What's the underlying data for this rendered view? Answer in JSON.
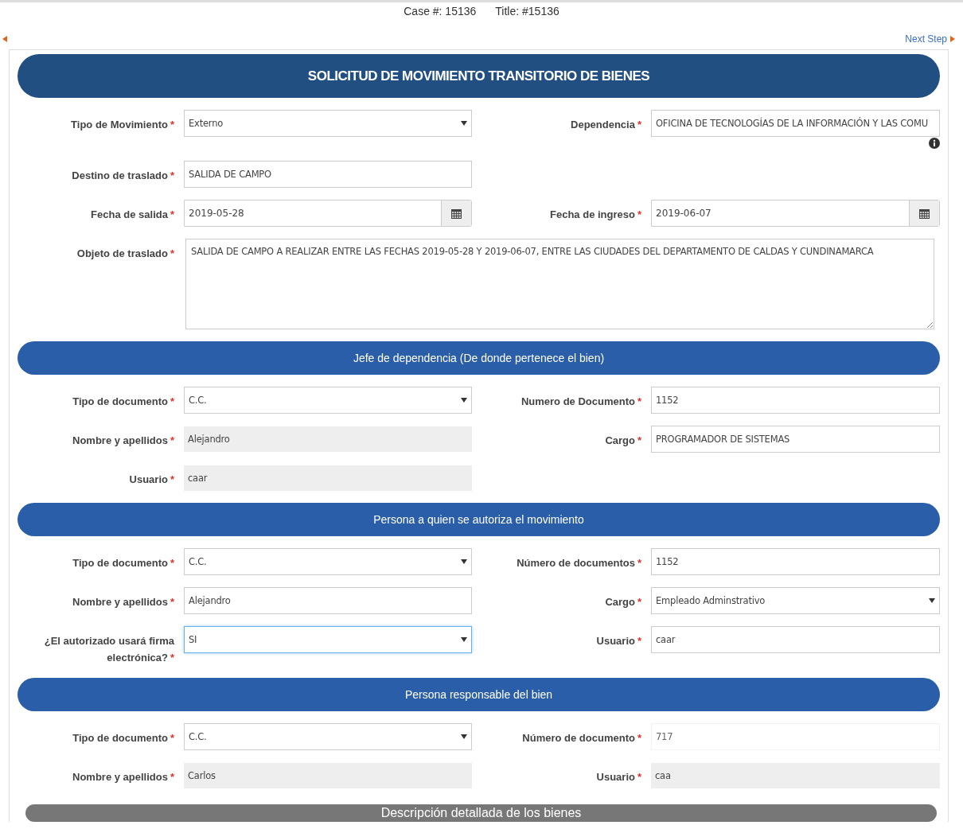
{
  "case_bar": {
    "case": "Case #: 15136",
    "title": "Title: #15136"
  },
  "nav": {
    "next": "Next Step"
  },
  "sections": [
    {
      "kind": "main",
      "title": "SOLICITUD DE MOVIMIENTO TRANSITORIO DE BIENES",
      "rows": [
        {
          "left": {
            "label": "Tipo de Movimiento",
            "mark": "*",
            "kind": "select",
            "value": "Externo",
            "focused": false
          },
          "right": {
            "label": "Dependencia",
            "mark": "*",
            "kind": "text",
            "value": "OFICINA DE TECNOLOGÍAS DE LA INFORMACIÓN Y LAS COMU",
            "info": true
          }
        },
        {
          "left": {
            "label": "Destino de traslado",
            "mark": "*",
            "kind": "text",
            "value": "SALIDA DE CAMPO"
          }
        },
        {
          "left": {
            "label": "Fecha de salida",
            "mark": "*",
            "kind": "date",
            "value": "2019-05-28"
          },
          "right": {
            "label": "Fecha de ingreso",
            "mark": "*",
            "kind": "date",
            "value": "2019-06-07"
          }
        },
        {
          "wide": {
            "label": "Objeto de traslado",
            "mark": "*",
            "kind": "textarea",
            "value": "SALIDA DE CAMPO A REALIZAR ENTRE LAS FECHAS 2019-05-28 Y 2019-06-07, ENTRE LAS CIUDADES DEL DEPARTAMENTO DE CALDAS Y CUNDINAMARCA"
          }
        }
      ]
    },
    {
      "kind": "sub",
      "title": "Jefe de dependencia (De donde pertenece el bien)",
      "rows": [
        {
          "left": {
            "label": "Tipo de documento",
            "mark": "*",
            "kind": "select",
            "value": "C.C.",
            "focused": false
          },
          "right": {
            "label": "Numero de Documento",
            "mark": "*",
            "kind": "text",
            "value": "1152"
          }
        },
        {
          "left": {
            "label": "Nombre y apellidos",
            "mark": "*",
            "kind": "readonly",
            "value": "Alejandro"
          },
          "right": {
            "label": "Cargo",
            "mark": "*",
            "kind": "text",
            "value": "PROGRAMADOR DE SISTEMAS"
          }
        },
        {
          "left": {
            "label": "Usuario",
            "mark": "*",
            "kind": "readonly",
            "value": "caar"
          }
        }
      ]
    },
    {
      "kind": "sub",
      "title": "Persona a quien se autoriza el movimiento",
      "rows": [
        {
          "left": {
            "label": "Tipo de documento",
            "mark": "*",
            "kind": "select",
            "value": "C.C.",
            "focused": false
          },
          "right": {
            "label": "Número de documentos",
            "mark": "*",
            "kind": "text",
            "value": "1152"
          }
        },
        {
          "left": {
            "label": "Nombre y apellidos",
            "mark": "*",
            "kind": "text",
            "value": "Alejandro"
          },
          "right": {
            "label": "Cargo",
            "mark": "*",
            "kind": "select",
            "value": "Empleado Adminstrativo",
            "focused": false
          }
        },
        {
          "left": {
            "label": "¿El autorizado usará firma electrónica?",
            "mark": "*",
            "kind": "select",
            "value": "SI",
            "focused": true
          },
          "right": {
            "label": "Usuario",
            "mark": "*",
            "kind": "text",
            "value": "caar"
          }
        }
      ]
    },
    {
      "kind": "sub",
      "title": "Persona responsable del bien",
      "rows": [
        {
          "left": {
            "label": "Tipo de documento",
            "mark": "*",
            "kind": "select",
            "value": "C.C.",
            "focused": false
          },
          "right": {
            "label": "Número de documento",
            "mark": "*",
            "kind": "plain",
            "value": "717"
          }
        },
        {
          "left": {
            "label": "Nombre y apellidos",
            "mark": "*",
            "kind": "readonly",
            "value": "Carlos"
          },
          "right": {
            "label": "Usuario",
            "mark": "*",
            "kind": "readonly",
            "value": "caa"
          }
        }
      ]
    },
    {
      "kind": "footer",
      "title": "Descripción detallada de los bienes"
    }
  ]
}
